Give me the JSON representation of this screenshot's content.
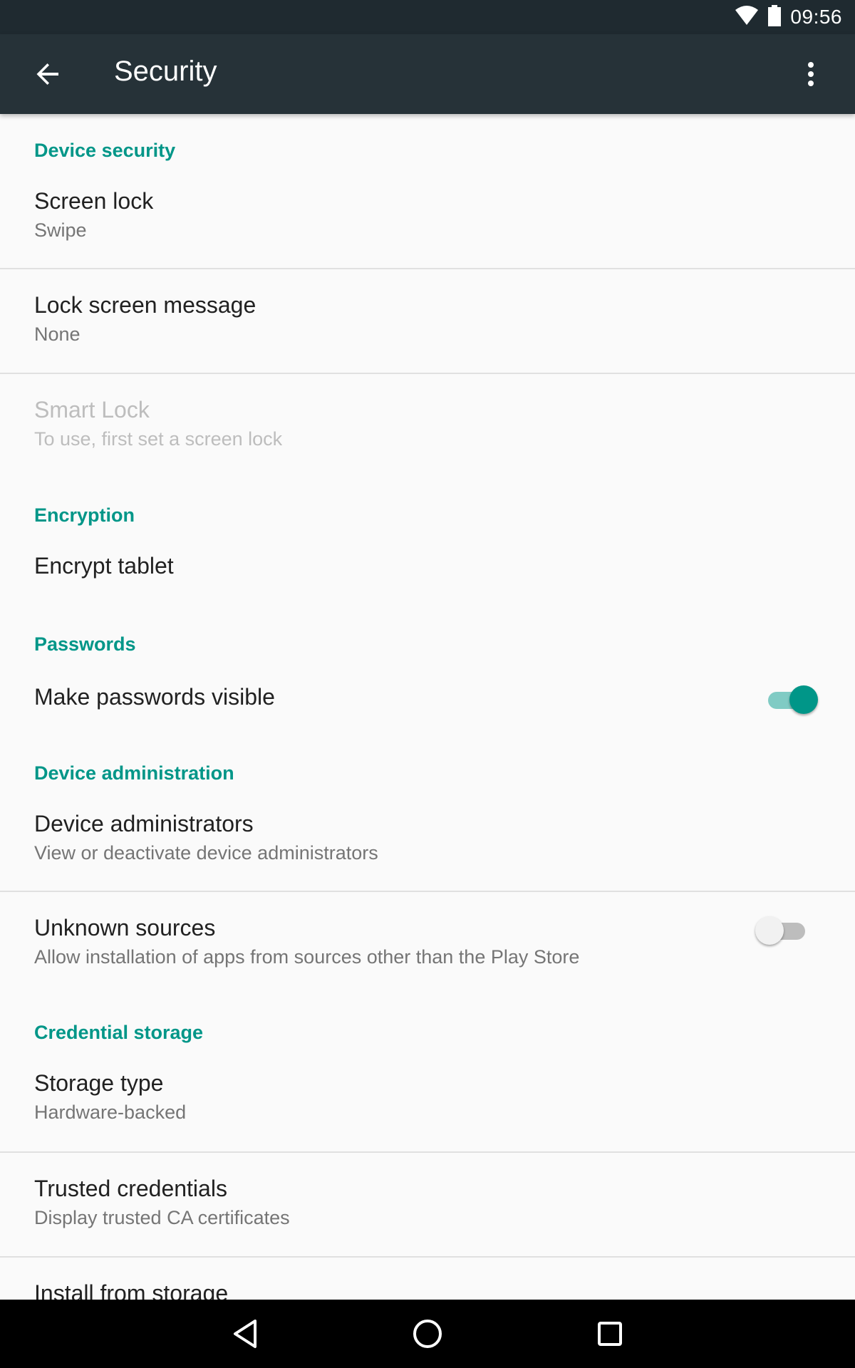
{
  "status_bar": {
    "time": "09:56",
    "icons": [
      "wifi-icon",
      "battery-icon"
    ]
  },
  "app_bar": {
    "title": "Security",
    "back_icon": "arrow-back-icon",
    "menu_icon": "more-vert-icon"
  },
  "sections": {
    "device_security": "Device security",
    "encryption": "Encryption",
    "passwords": "Passwords",
    "device_administration": "Device administration",
    "credential_storage": "Credential storage"
  },
  "items": {
    "screen_lock": {
      "title": "Screen lock",
      "summary": "Swipe"
    },
    "lock_screen_message": {
      "title": "Lock screen message",
      "summary": "None"
    },
    "smart_lock": {
      "title": "Smart Lock",
      "summary": "To use, first set a screen lock",
      "enabled": false
    },
    "encrypt_tablet": {
      "title": "Encrypt tablet"
    },
    "make_passwords_visible": {
      "title": "Make passwords visible",
      "checked": true
    },
    "device_administrators": {
      "title": "Device administrators",
      "summary": "View or deactivate device administrators"
    },
    "unknown_sources": {
      "title": "Unknown sources",
      "summary": "Allow installation of apps from sources other than the Play Store",
      "checked": false
    },
    "storage_type": {
      "title": "Storage type",
      "summary": "Hardware-backed"
    },
    "trusted_credentials": {
      "title": "Trusted credentials",
      "summary": "Display trusted CA certificates"
    },
    "install_from_storage": {
      "title": "Install from storage"
    }
  },
  "nav_bar": {
    "buttons": [
      "back-triangle-icon",
      "home-circle-icon",
      "recents-square-icon"
    ]
  },
  "colors": {
    "accent": "#009688",
    "app_bar": "#263238",
    "status_bar": "#1f2a30",
    "background": "#fafafa"
  }
}
